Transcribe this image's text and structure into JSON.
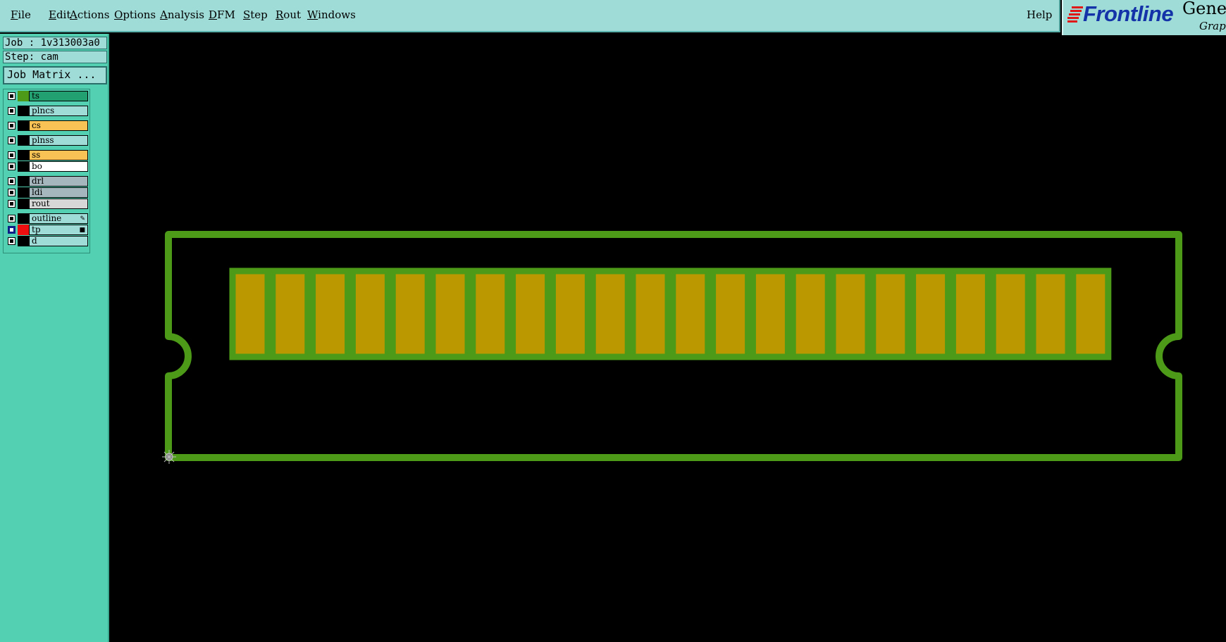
{
  "menu": {
    "items": [
      {
        "label": "File",
        "ul": "F",
        "rest": "ile"
      },
      {
        "label": "Edit",
        "ul": "E",
        "rest": "dit"
      },
      {
        "label": "Actions",
        "ul": "A",
        "rest": "ctions"
      },
      {
        "label": "Options",
        "ul": "O",
        "rest": "ptions"
      },
      {
        "label": "Analysis",
        "ul": "A",
        "rest": "nalysis"
      },
      {
        "label": "DFM",
        "ul": "D",
        "rest": "FM"
      },
      {
        "label": "Step",
        "ul": "S",
        "rest": "tep"
      },
      {
        "label": "Rout",
        "ul": "R",
        "rest": "out"
      },
      {
        "label": "Windows",
        "ul": "W",
        "rest": "indows"
      }
    ],
    "help": "Help"
  },
  "logo": {
    "brand": "Frontline",
    "product": "Genes",
    "subtitle": "Graph"
  },
  "info": {
    "job": "Job : 1v313003a0",
    "step": "Step: cam",
    "job_matrix_button": "Job Matrix ..."
  },
  "layers": [
    {
      "name": "ts",
      "color": "#23a071",
      "swatch": "#4c9a18",
      "checked": false
    },
    {
      "name": "plncs",
      "color": "#9fdcd8",
      "swatch": "#000000",
      "checked": false
    },
    {
      "name": "cs",
      "color": "#f9c254",
      "swatch": "#000000",
      "checked": false
    },
    {
      "name": "plnss",
      "color": "#9fdcd8",
      "swatch": "#000000",
      "checked": false
    },
    {
      "name": "ss",
      "color": "#f9c254",
      "swatch": "#000000",
      "checked": false
    },
    {
      "name": "bo",
      "color": "#ffffff",
      "swatch": "#000000",
      "checked": false
    },
    {
      "name": "drl",
      "color": "#a6b6bd",
      "swatch": "#000000",
      "checked": false
    },
    {
      "name": "ldi",
      "color": "#a6b6bd",
      "swatch": "#000000",
      "checked": false
    },
    {
      "name": "rout",
      "color": "#d7d7d7",
      "swatch": "#000000",
      "checked": false
    },
    {
      "name": "outline",
      "color": "#9fdcd8",
      "swatch": "#000000",
      "checked": false,
      "mark": "pencil"
    },
    {
      "name": "tp",
      "color": "#9fdcd8",
      "swatch": "#ee1010",
      "checked": true,
      "mark": "dot"
    },
    {
      "name": "d",
      "color": "#9fdcd8",
      "swatch": "#000000",
      "checked": false
    }
  ],
  "board": {
    "pad_count": 22,
    "outline_color": "#4c9a18",
    "pad_fill": "#bb9800",
    "pad_border": "#4c9a18",
    "origin_marker": "datum-origin-icon"
  }
}
